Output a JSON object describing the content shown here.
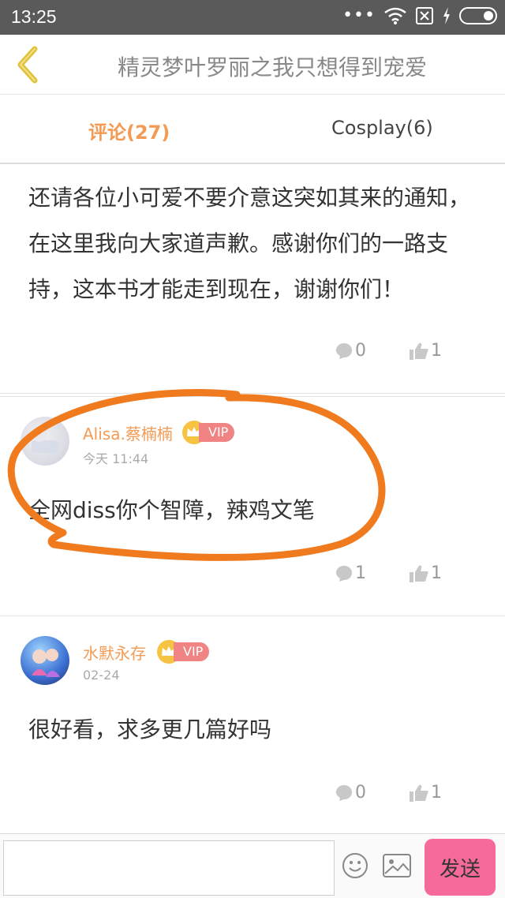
{
  "status_bar": {
    "time": "13:25",
    "dots": "•••"
  },
  "header": {
    "title": "精灵梦叶罗丽之我只想得到宠爱"
  },
  "tabs": [
    {
      "label": "评论(27)",
      "active": true
    },
    {
      "label": "Cosplay(6)",
      "active": false
    }
  ],
  "comments": [
    {
      "text": "还请各位小可爱不要介意这突如其来的通知，在这里我向大家道声歉。感谢你们的一路支持，这本书才能走到现在，谢谢你们！",
      "reply_count": "0",
      "like_count": "1"
    },
    {
      "user": "Alisa.蔡楠楠",
      "badge": "VIP",
      "time": "今天 11:44",
      "text": "全网diss你个智障，辣鸡文笔",
      "reply_count": "1",
      "like_count": "1"
    },
    {
      "user": "水默永存",
      "badge": "VIP",
      "time": "02-24",
      "text": "很好看，求多更几篇好吗",
      "reply_count": "0",
      "like_count": "1"
    }
  ],
  "composer": {
    "input_value": "",
    "send_label": "发送"
  },
  "colors": {
    "accent": "#f39b54",
    "vip": "#f08383",
    "send": "#f56a9a",
    "annotation": "#f07a1e"
  }
}
